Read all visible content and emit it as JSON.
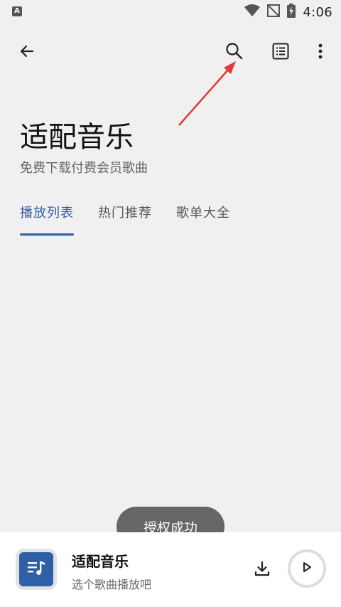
{
  "status_bar": {
    "time": "4:06",
    "left_icon": "A"
  },
  "header": {
    "back_icon": "arrow-left-icon",
    "search_icon": "search-icon",
    "list_icon": "list-icon",
    "more_icon": "more-vertical-icon"
  },
  "main": {
    "title": "适配音乐",
    "subtitle": "免费下载付费会员歌曲",
    "tabs": [
      {
        "label": "播放列表",
        "active": true
      },
      {
        "label": "热门推荐",
        "active": false
      },
      {
        "label": "歌单大全",
        "active": false
      }
    ]
  },
  "toast": {
    "text": "授权成功"
  },
  "player": {
    "title": "适配音乐",
    "subtitle": "选个歌曲播放吧",
    "cover_icon": "music-list-icon",
    "download_icon": "download-icon",
    "play_icon": "play-icon"
  },
  "colors": {
    "accent": "#2f5fa6",
    "background": "#f0f0f0",
    "toast_bg": "#666666",
    "annotation_arrow": "#e53935"
  }
}
